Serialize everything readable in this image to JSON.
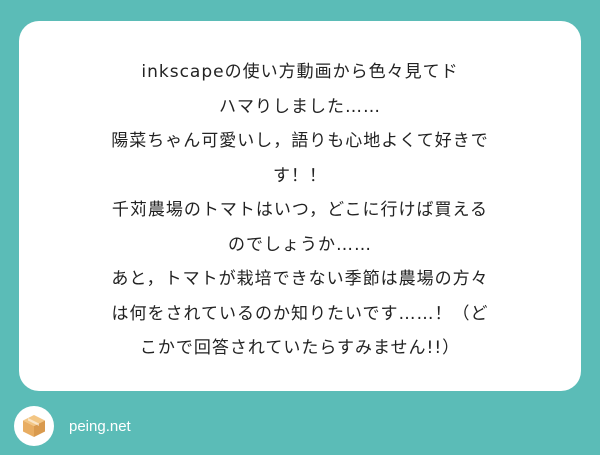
{
  "question": {
    "lines": [
      "inkscapeの使い方動画から色々見てド",
      "ハマりしました……",
      "陽菜ちゃん可愛いし，語りも心地よくて好きで",
      "す！！",
      "千苅農場のトマトはいつ，どこに行けば買える",
      "のでしょうか……",
      "あと，トマトが栽培できない季節は農場の方々",
      "は何をされているのか知りたいです……！（ど",
      "こかで回答されていたらすみません!!）"
    ]
  },
  "footer": {
    "logo_icon": "peing-box-icon",
    "brand": "peing.net"
  },
  "colors": {
    "background": "#5bbcb7",
    "card": "#ffffff",
    "text": "#222222",
    "box_top": "#f3c684",
    "box_side": "#d99a4e"
  }
}
